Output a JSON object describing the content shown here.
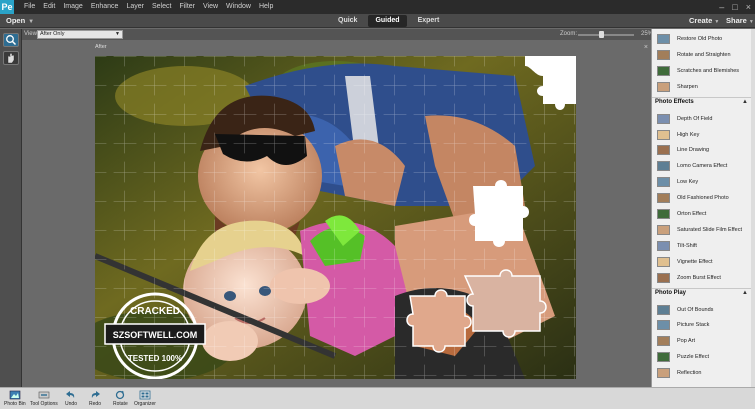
{
  "menubar": {
    "app_icon": "Pe",
    "items": [
      "File",
      "Edit",
      "Image",
      "Enhance",
      "Layer",
      "Select",
      "Filter",
      "View",
      "Window",
      "Help"
    ],
    "controls": {
      "minimize": "–",
      "restore": "□",
      "close": "×"
    }
  },
  "modebar": {
    "open_label": "Open",
    "tabs": [
      "Quick",
      "Guided",
      "Expert"
    ],
    "active_tab": "Guided",
    "create_label": "Create",
    "share_label": "Share"
  },
  "options": {
    "view_label": "View:",
    "view_value": "After Only",
    "zoom_label": "Zoom:",
    "zoom_value": "25%",
    "zoom_level": 0.25
  },
  "canvas": {
    "after_label": "After",
    "close_symbol": "×"
  },
  "watermark": {
    "line1": "CRACKED",
    "line2": "SZSOFTWELL.COM",
    "line3": "TESTED 100%"
  },
  "panel": {
    "top_items": [
      "Restore Old Photo",
      "Rotate and Straighten",
      "Scratches and Blemishes",
      "Sharpen"
    ],
    "sections": [
      {
        "title": "Photo Effects",
        "items": [
          "Depth Of Field",
          "High Key",
          "Line Drawing",
          "Lomo Camera Effect",
          "Low Key",
          "Old Fashioned Photo",
          "Orton Effect",
          "Saturated Slide Film Effect",
          "Tilt-Shift",
          "Vignette Effect",
          "Zoom Burst Effect"
        ]
      },
      {
        "title": "Photo Play",
        "items": [
          "Out Of Bounds",
          "Picture Stack",
          "Pop Art",
          "Puzzle Effect",
          "Reflection"
        ]
      }
    ]
  },
  "bottombar": {
    "items": [
      "Photo Bin",
      "Tool Options",
      "Undo",
      "Redo",
      "Rotate",
      "Organizer"
    ]
  },
  "colors": {
    "accent": "#2aa3c8",
    "menubar_bg": "#2b2b2b",
    "panel_bg": "#efefef",
    "canvas_bg": "#6a6a6a"
  }
}
